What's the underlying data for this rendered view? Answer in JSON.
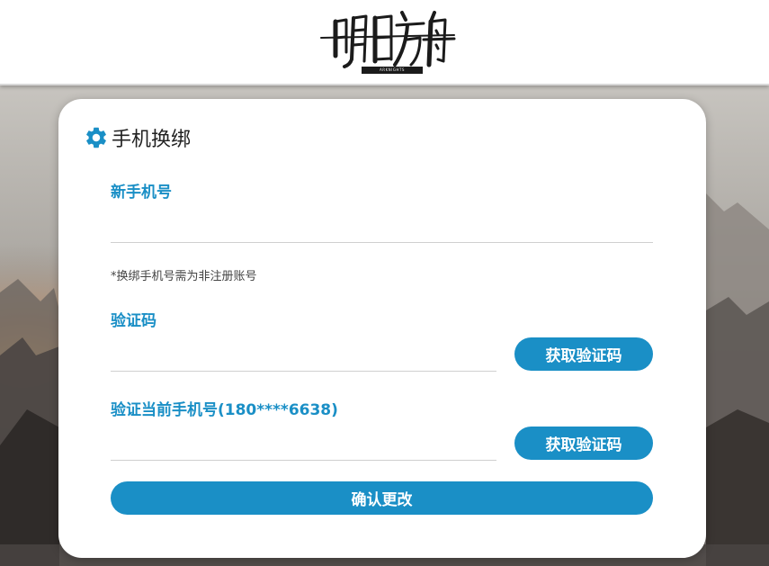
{
  "header": {
    "logo_text": "明日方舟",
    "logo_subtext": "ARKNIGHTS"
  },
  "card": {
    "title": "手机换绑",
    "new_phone": {
      "label": "新手机号",
      "value": "",
      "placeholder": ""
    },
    "hint": "*换绑手机号需为非注册账号",
    "verify_code": {
      "label": "验证码",
      "value": "",
      "placeholder": "",
      "button_label": "获取验证码"
    },
    "verify_current": {
      "label": "验证当前手机号(180****6638)",
      "value": "",
      "placeholder": "",
      "button_label": "获取验证码"
    },
    "confirm_label": "确认更改"
  },
  "icons": {
    "title_icon": "gear-icon"
  },
  "colors": {
    "accent": "#1a8fc6",
    "card_bg": "#ffffff",
    "header_bg": "#ffffff"
  }
}
